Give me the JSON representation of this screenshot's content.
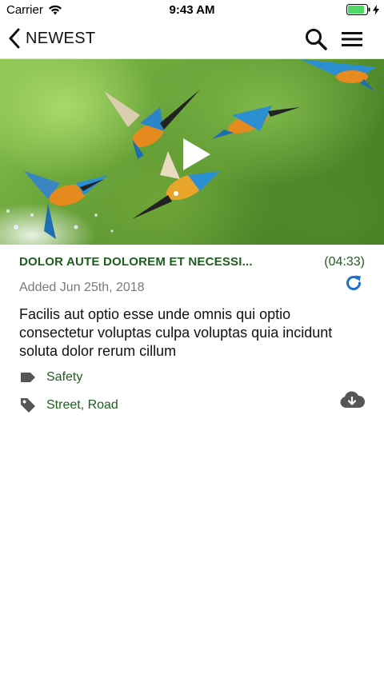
{
  "status_bar": {
    "carrier": "Carrier",
    "time": "9:43 AM",
    "battery_color": "#4cd964"
  },
  "nav": {
    "title": "NEWEST",
    "icons": [
      "chevron-left-icon",
      "search-icon",
      "menu-icon"
    ]
  },
  "video": {
    "title": "DOLOR AUTE DOLOREM ET NECESSI...",
    "duration": "(04:33)",
    "added": "Added Jun 25th, 2018",
    "description": "Facilis aut optio esse unde omnis qui optio consectetur voluptas culpa voluptas quia incidunt soluta dolor rerum cillum",
    "category": "Safety",
    "tags": "Street, Road"
  },
  "colors": {
    "accent_green": "#1e5e1c",
    "icon_blue": "#1a73c9",
    "icon_gray": "#555555"
  }
}
